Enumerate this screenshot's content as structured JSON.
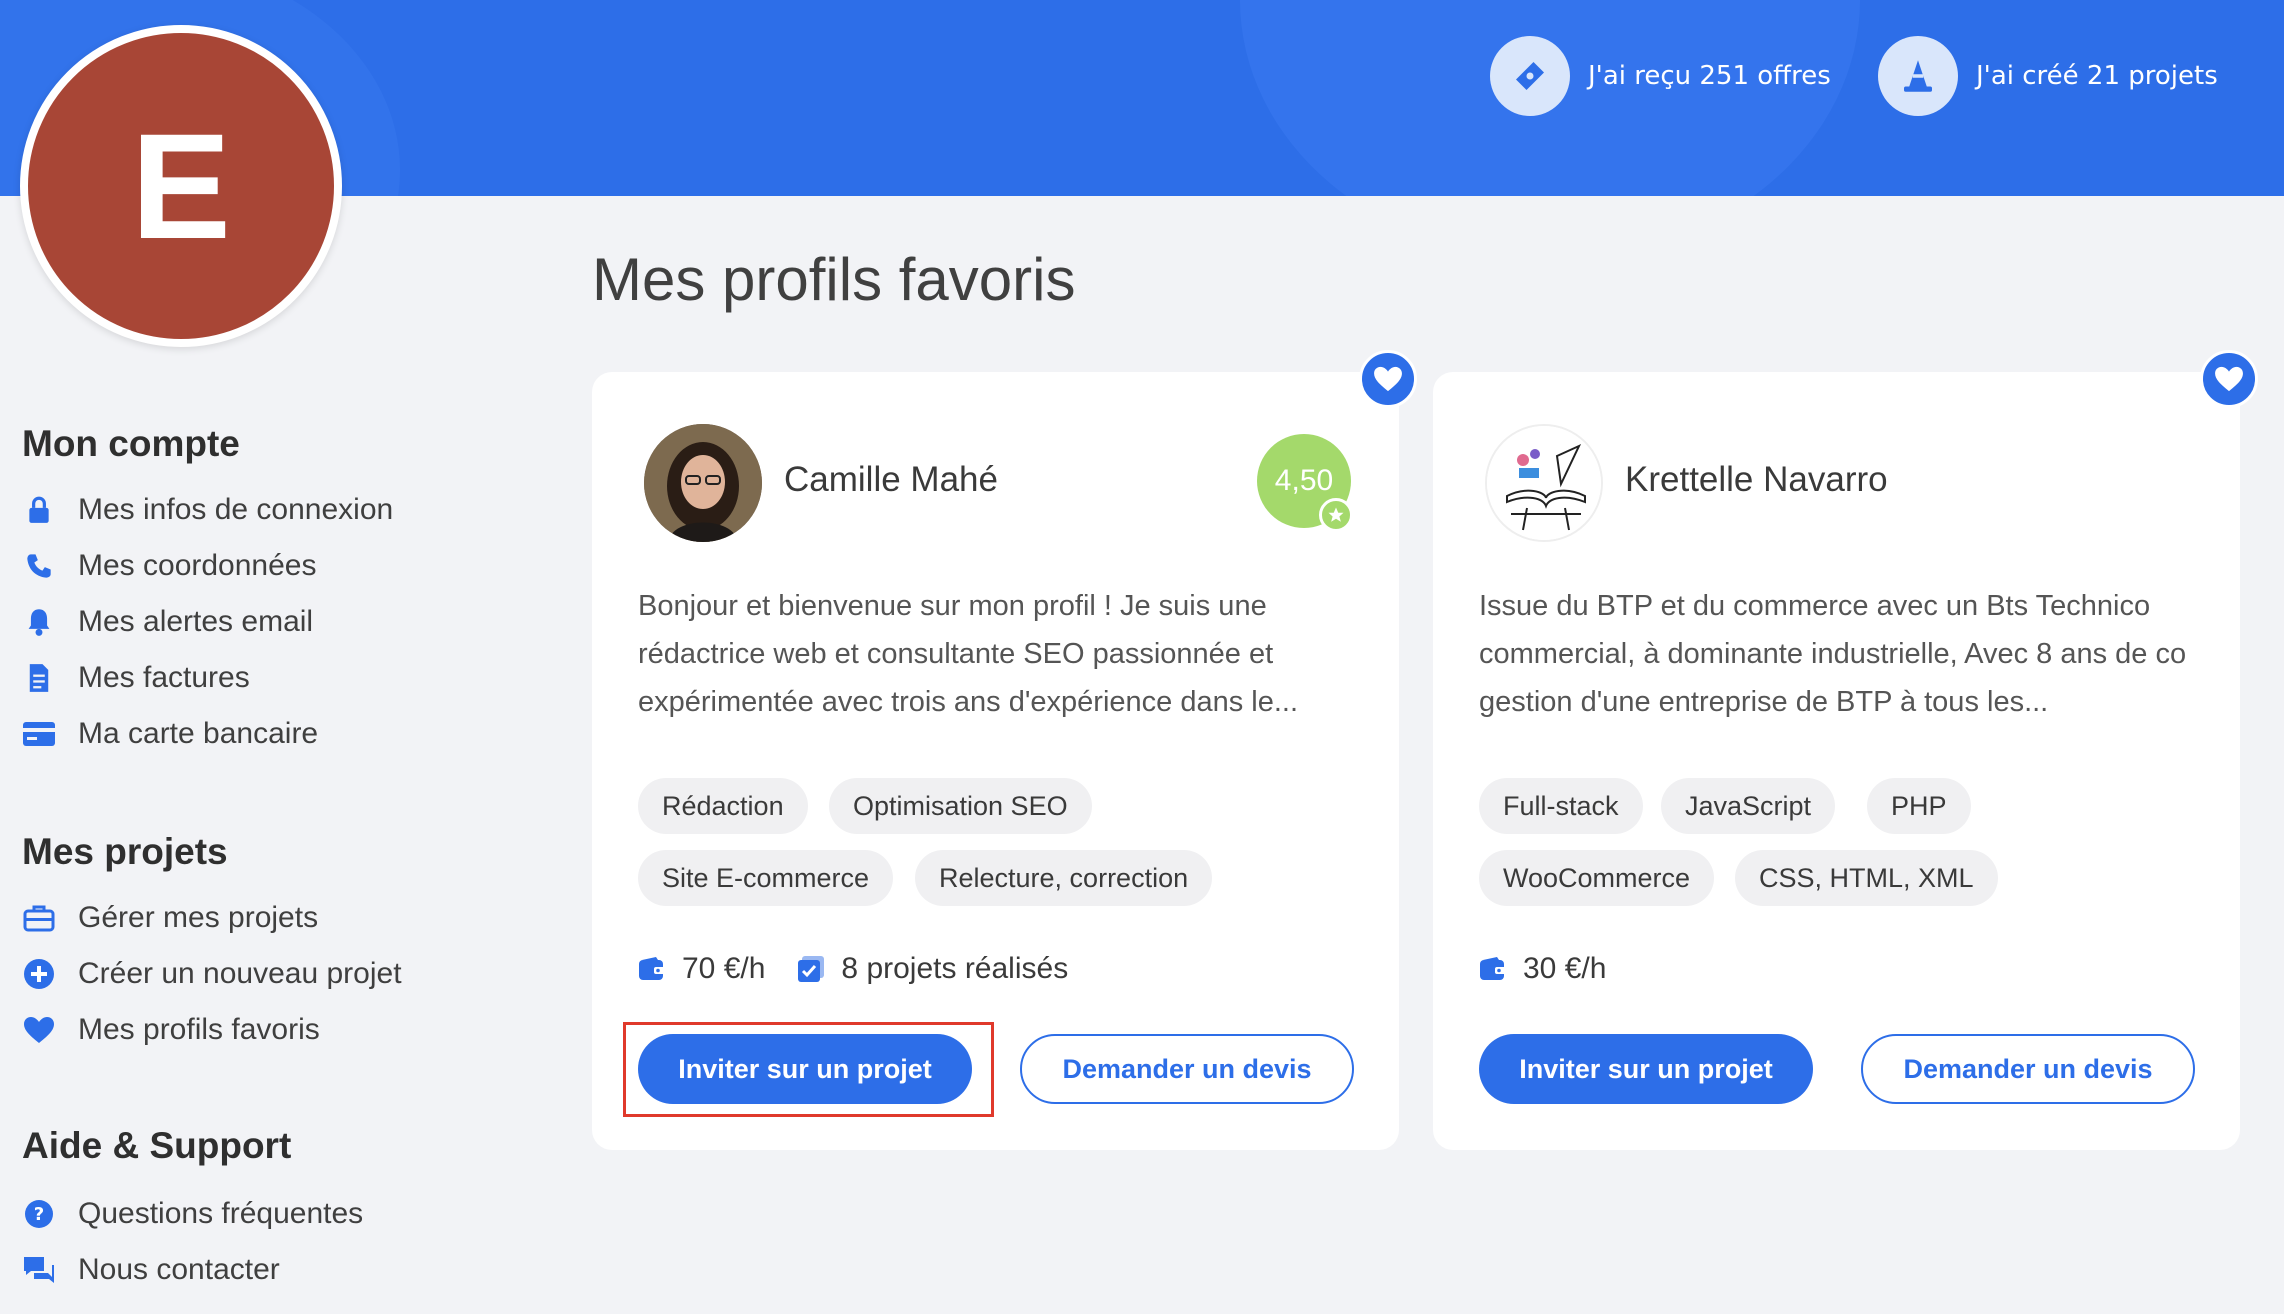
{
  "header": {
    "stats": [
      {
        "icon": "ticket-icon",
        "label": "J'ai reçu 251 offres"
      },
      {
        "icon": "cone-icon",
        "label": "J'ai créé 21 projets"
      }
    ]
  },
  "user": {
    "avatar_letter": "E",
    "avatar_color": "#a84636"
  },
  "sidebar": {
    "sections": [
      {
        "title": "Mon compte",
        "items": [
          {
            "icon": "lock-icon",
            "label": "Mes infos de connexion"
          },
          {
            "icon": "phone-icon",
            "label": "Mes coordonnées"
          },
          {
            "icon": "bell-icon",
            "label": "Mes alertes email"
          },
          {
            "icon": "invoice-icon",
            "label": "Mes factures"
          },
          {
            "icon": "credit-card-icon",
            "label": "Ma carte bancaire"
          }
        ]
      },
      {
        "title": "Mes projets",
        "items": [
          {
            "icon": "briefcase-icon",
            "label": "Gérer mes projets"
          },
          {
            "icon": "plus-circle-icon",
            "label": "Créer un nouveau projet"
          },
          {
            "icon": "heart-icon",
            "label": "Mes profils favoris"
          }
        ]
      },
      {
        "title": "Aide & Support",
        "items": [
          {
            "icon": "question-icon",
            "label": "Questions fréquentes"
          },
          {
            "icon": "chat-icon",
            "label": "Nous contacter"
          }
        ]
      }
    ]
  },
  "main": {
    "title": "Mes profils favoris",
    "profiles": [
      {
        "name": "Camille Mahé",
        "rating": "4,50",
        "bio": "Bonjour et bienvenue sur mon profil ! Je suis une rédactrice web et consultante SEO passionnée et expérimentée avec trois ans d'expérience dans le...",
        "tags": [
          "Rédaction",
          "Optimisation SEO",
          "Site E-commerce",
          "Relecture, correction"
        ],
        "rate": "70 €/h",
        "projects_done": "8 projets réalisés",
        "invite_label": "Inviter sur un projet",
        "quote_label": "Demander un devis"
      },
      {
        "name": "Krettelle Navarro",
        "bio": "Issue du BTP et du commerce avec un Bts Technico commercial, à dominante industrielle, Avec 8 ans de co gestion d'une entreprise de BTP à tous les...",
        "tags": [
          "Full-stack",
          "JavaScript",
          "PHP",
          "WooCommerce",
          "CSS, HTML, XML"
        ],
        "rate": "30 €/h",
        "invite_label": "Inviter sur un projet",
        "quote_label": "Demander un devis"
      }
    ]
  },
  "colors": {
    "primary": "#2d6ee8",
    "rating_badge": "#a4d96b",
    "highlight": "#e0392b"
  }
}
